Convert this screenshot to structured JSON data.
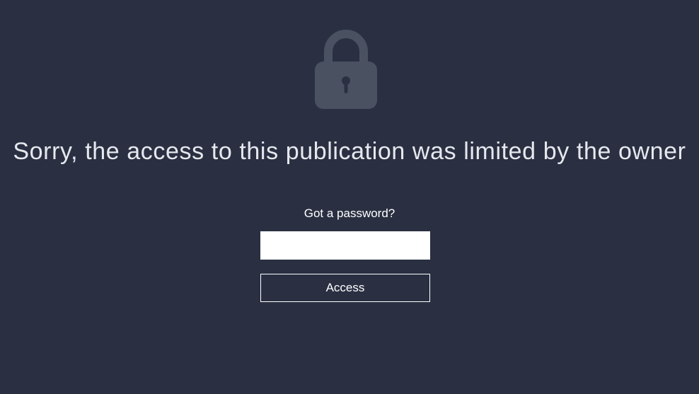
{
  "lock": {
    "icon": "lock-icon",
    "color": "#4a5262"
  },
  "message": "Sorry, the access to this publication was limited by the owner",
  "password": {
    "prompt": "Got a password?",
    "value": "",
    "placeholder": ""
  },
  "access_button": {
    "label": "Access"
  },
  "colors": {
    "background": "#2a3042",
    "text": "#ffffff",
    "input_bg": "#ffffff"
  }
}
